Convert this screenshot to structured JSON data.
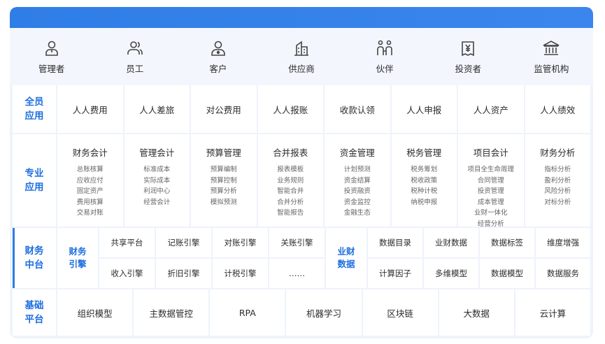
{
  "roles": [
    {
      "label": "管理者",
      "icon": "person-icon"
    },
    {
      "label": "员工",
      "icon": "people-icon"
    },
    {
      "label": "客户",
      "icon": "customer-icon"
    },
    {
      "label": "供应商",
      "icon": "building-icon"
    },
    {
      "label": "伙伴",
      "icon": "partner-icon"
    },
    {
      "label": "投资者",
      "icon": "yen-document-icon"
    },
    {
      "label": "监管机构",
      "icon": "institution-icon"
    }
  ],
  "all_staff": {
    "label_line1": "全员",
    "label_line2": "应用",
    "items": [
      "人人费用",
      "人人差旅",
      "对公费用",
      "人人报账",
      "收款认领",
      "人人申报",
      "人人资产",
      "人人绩效"
    ]
  },
  "professional": {
    "label_line1": "专业",
    "label_line2": "应用",
    "columns": [
      {
        "title": "财务会计",
        "items": [
          "总账核算",
          "应收应付",
          "固定资产",
          "费用核算",
          "交易对账"
        ]
      },
      {
        "title": "管理会计",
        "items": [
          "标准成本",
          "实际成本",
          "利润中心",
          "经营会计"
        ]
      },
      {
        "title": "预算管理",
        "items": [
          "预算编制",
          "预算控制",
          "预算分析",
          "模拟预测"
        ]
      },
      {
        "title": "合并报表",
        "items": [
          "报表模板",
          "业务规则",
          "智能合并",
          "合并分析",
          "智能报告"
        ]
      },
      {
        "title": "资金管理",
        "items": [
          "计划预测",
          "资金结算",
          "投资融资",
          "资金监控",
          "金融生态"
        ]
      },
      {
        "title": "税务管理",
        "items": [
          "税务筹划",
          "税收政策",
          "税种计税",
          "纳税申报"
        ]
      },
      {
        "title": "项目会计",
        "items": [
          "项目全生命周理",
          "合同管理",
          "投资管理",
          "成本管理",
          "业财一体化",
          "经营分析"
        ]
      },
      {
        "title": "财务分析",
        "items": [
          "指标分析",
          "盈利分析",
          "风险分析",
          "对标分析"
        ]
      }
    ]
  },
  "middle": {
    "label_line1": "财务",
    "label_line2": "中台",
    "engine": {
      "label_line1": "财务",
      "label_line2": "引擎",
      "cells": [
        "共享平台",
        "记账引擎",
        "对账引擎",
        "关账引擎",
        "收入引擎",
        "折旧引擎",
        "计税引擎",
        "……"
      ]
    },
    "data": {
      "label_line1": "业财",
      "label_line2": "数据",
      "cells": [
        "数据目录",
        "业财数据",
        "数据标签",
        "维度增强",
        "计算因子",
        "多维模型",
        "数据模型",
        "数据服务"
      ]
    }
  },
  "base": {
    "label_line1": "基础",
    "label_line2": "平台",
    "items": [
      "组织模型",
      "主数据管控",
      "RPA",
      "机器学习",
      "区块链",
      "大数据",
      "云计算"
    ]
  },
  "colors": {
    "accent": "#2f7de6",
    "label_text": "#1f6fe0",
    "bg": "#eef3fb"
  }
}
